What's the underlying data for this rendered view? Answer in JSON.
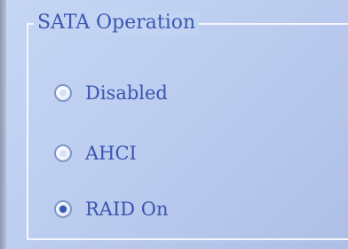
{
  "group": {
    "title": "SATA Operation"
  },
  "options": [
    {
      "label": "Disabled",
      "selected": false
    },
    {
      "label": "AHCI",
      "selected": false
    },
    {
      "label": "RAID On",
      "selected": true
    }
  ]
}
